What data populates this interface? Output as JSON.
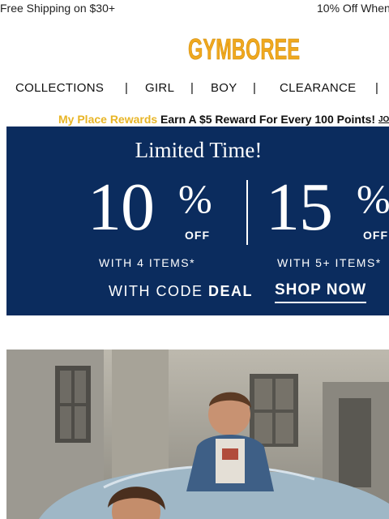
{
  "topbar": {
    "free_shipping": "Free Shipping on $30+",
    "promo_offer": "10% Off When"
  },
  "brand": {
    "logo_text": "GYMBOREE",
    "logo_color": "#f0a81e"
  },
  "nav": {
    "items": [
      "COLLECTIONS",
      "GIRL",
      "BOY",
      "CLEARANCE"
    ],
    "separator": "|"
  },
  "rewards": {
    "program_name": "My Place Rewards",
    "message": "Earn A $5 Reward For Every 100 Points!",
    "join_link": "JO",
    "program_color": "#e8b526"
  },
  "promo_banner": {
    "headline": "Limited Time!",
    "offer_1": {
      "value": "10",
      "unit": "%",
      "off": "OFF",
      "condition": "WITH 4 ITEMS*"
    },
    "offer_2": {
      "value": "15",
      "unit": "%",
      "off": "OFF",
      "condition": "WITH 5+ ITEMS*"
    },
    "code_prefix": "WITH CODE",
    "code": "DEAL",
    "cta": "SHOP NOW",
    "background_color": "#0b2c5e"
  },
  "hero_photo": {
    "image_icon": "kids-on-car-photo-icon"
  }
}
